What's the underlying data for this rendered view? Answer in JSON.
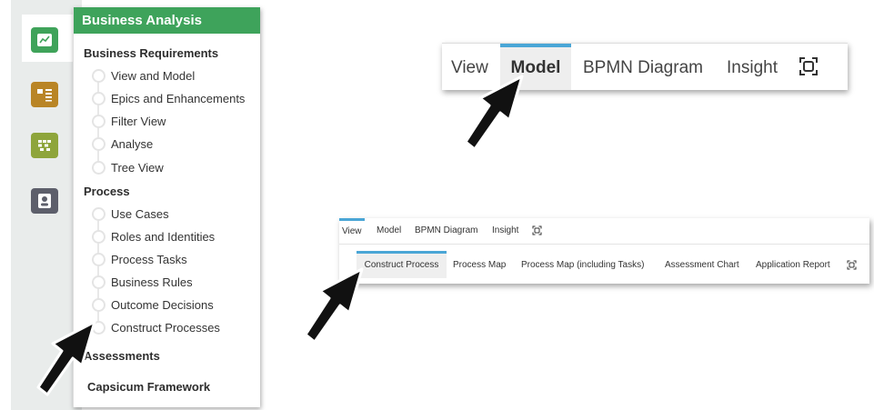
{
  "sidebar": {
    "icons": [
      "chart-report-icon",
      "process-board-icon",
      "grid-matrix-icon",
      "user-card-icon"
    ]
  },
  "panel": {
    "header": "Business Analysis",
    "sections": {
      "business_requirements": "Business Requirements",
      "process": "Process",
      "assessments": "Assessments",
      "capsicum": "Capsicum Framework"
    },
    "business_requirements_items": [
      "View and Model",
      "Epics and Enhancements",
      "Filter View",
      "Analyse",
      "Tree View"
    ],
    "process_items": [
      "Use Cases",
      "Roles and Identities",
      "Process Tasks",
      "Business Rules",
      "Outcome Decisions",
      "Construct Processes"
    ]
  },
  "big_nav": {
    "tabs": [
      "View",
      "Model",
      "BPMN Diagram",
      "Insight"
    ],
    "active": "Model",
    "expand_icon": "expand-icon"
  },
  "small_nav": {
    "tabs": [
      "View",
      "Model",
      "BPMN Diagram",
      "Insight"
    ],
    "active": "View",
    "sub_tabs": [
      "Construct Process",
      "Process Map",
      "Process Map (including Tasks)",
      "Assessment Chart",
      "Application Report"
    ],
    "active_sub": "Construct Process"
  },
  "colors": {
    "brand_green": "#3ea35b",
    "accent_blue": "#4aa6d6"
  }
}
